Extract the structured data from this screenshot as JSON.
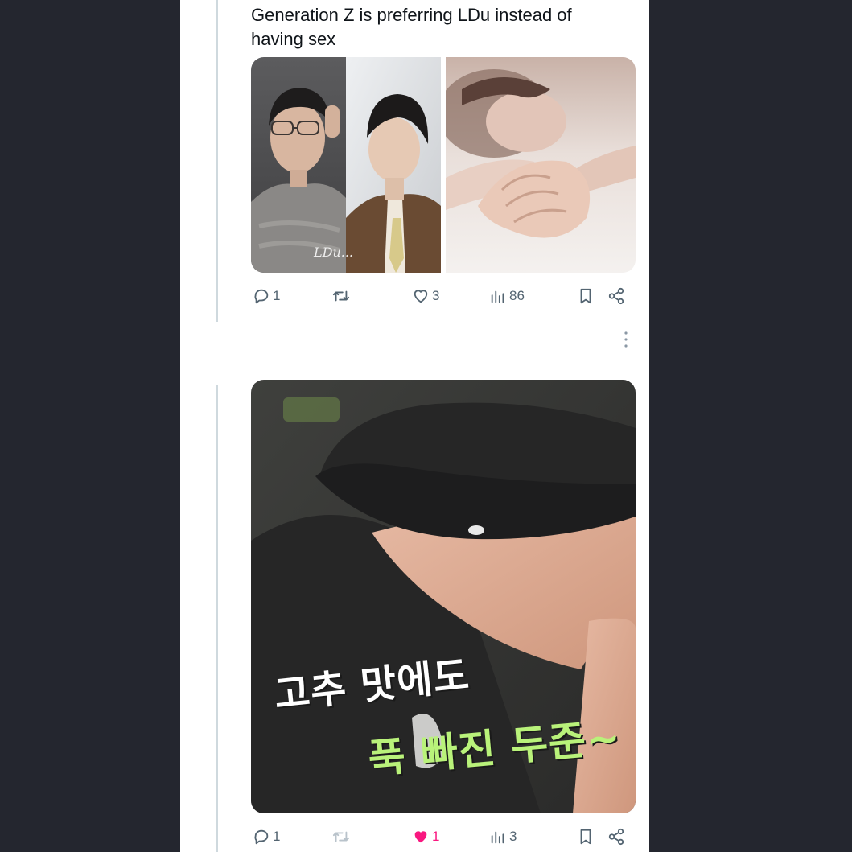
{
  "colors": {
    "background": "#24262f",
    "card": "#ffffff",
    "text": "#0f1419",
    "muted": "#536471",
    "liked": "#f91880",
    "subtitle_white": "#ffffff",
    "subtitle_green": "#b9f27a"
  },
  "tweet1": {
    "text": "Generation Z is preferring LDu instead of having sex",
    "media_left_watermark": "LDu...",
    "actions": {
      "reply_count": "1",
      "retweet_count": "",
      "like_count": "3",
      "views_count": "86"
    },
    "icons": [
      "reply-icon",
      "retweet-icon",
      "like-icon",
      "views-icon",
      "bookmark-icon",
      "share-icon"
    ]
  },
  "tweet2": {
    "subtitle_line1": "고추 맛에도",
    "subtitle_line2": "푹 빠진 두준~",
    "actions": {
      "reply_count": "1",
      "retweet_count": "",
      "like_count": "1",
      "liked": true,
      "views_count": "3"
    },
    "icons": [
      "reply-icon",
      "retweet-icon",
      "like-filled-icon",
      "views-icon",
      "bookmark-icon",
      "share-icon"
    ]
  }
}
